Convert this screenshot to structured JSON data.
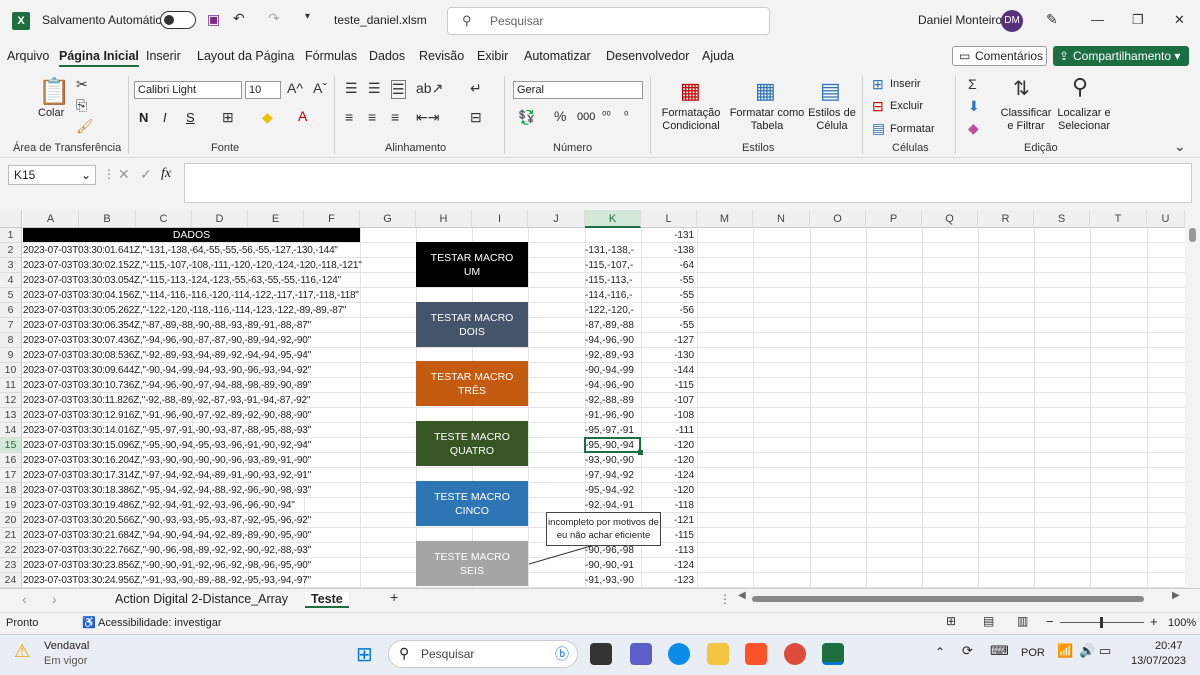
{
  "titlebar": {
    "autosave_label": "Salvamento Automático",
    "filename": "teste_daniel.xlsm",
    "search_placeholder": "Pesquisar",
    "user_name": "Daniel Monteiro",
    "user_initials": "DM"
  },
  "menu": {
    "items": [
      "Arquivo",
      "Página Inicial",
      "Inserir",
      "Layout da Página",
      "Fórmulas",
      "Dados",
      "Revisão",
      "Exibir",
      "Automatizar",
      "Desenvolvedor",
      "Ajuda"
    ],
    "comments": "Comentários",
    "share": "Compartilhamento"
  },
  "ribbon": {
    "clipboard": {
      "paste": "Colar",
      "group": "Área de Transferência"
    },
    "font": {
      "name": "Calibri Light",
      "size": "10",
      "bold": "N",
      "italic": "I",
      "underline": "S",
      "group": "Fonte"
    },
    "alignment": {
      "group": "Alinhamento"
    },
    "number": {
      "format": "Geral",
      "group": "Número"
    },
    "styles": {
      "conditional": "Formatação Condicional",
      "table": "Formatar como Tabela",
      "cell_styles": "Estilos de Célula",
      "group": "Estilos"
    },
    "cells": {
      "insert": "Inserir",
      "delete": "Excluir",
      "format": "Formatar",
      "group": "Células"
    },
    "editing": {
      "sort": "Classificar e Filtrar",
      "find": "Localizar e Selecionar",
      "group": "Edição"
    }
  },
  "formula": {
    "namebox": "K15",
    "fx": "fx",
    "value": ""
  },
  "columns": [
    "A",
    "B",
    "C",
    "D",
    "E",
    "F",
    "G",
    "H",
    "I",
    "J",
    "K",
    "L",
    "M",
    "N",
    "O",
    "P",
    "Q",
    "R",
    "S",
    "T",
    "U"
  ],
  "rows": [
    "1",
    "2",
    "3",
    "4",
    "5",
    "6",
    "7",
    "8",
    "9",
    "10",
    "11",
    "12",
    "13",
    "14",
    "15",
    "16",
    "17",
    "18",
    "19",
    "20",
    "21",
    "22",
    "23",
    "24"
  ],
  "header_cell": "DADOS",
  "colA": [
    "2023-07-03T03:30:01.641Z,\"-131,-138,-64,-55,-55,-56,-55,-127,-130,-144\"",
    "2023-07-03T03:30:02.152Z,\"-115,-107,-108,-111,-120,-120,-124,-120,-118,-121\"",
    "2023-07-03T03:30:03.054Z,\"-115,-113,-124,-123,-55,-63,-55,-55,-116,-124\"",
    "2023-07-03T03:30:04.156Z,\"-114,-116,-116,-120,-114,-122,-117,-117,-118,-118\"",
    "2023-07-03T03:30:05.262Z,\"-122,-120,-118,-116,-114,-123,-122,-89,-89,-87\"",
    "2023-07-03T03:30:06.354Z,\"-87,-89,-88,-90,-88,-93,-89,-91,-88,-87\"",
    "2023-07-03T03:30:07.436Z,\"-94,-96,-90,-87,-87,-90,-89,-94,-92,-90\"",
    "2023-07-03T03:30:08.536Z,\"-92,-89,-93,-94,-89,-92,-94,-94,-95,-94\"",
    "2023-07-03T03:30:09.644Z,\"-90,-94,-99,-94,-93,-90,-96,-93,-94,-92\"",
    "2023-07-03T03:30:10.736Z,\"-94,-96,-90,-97,-94,-88,-98,-89,-90,-89\"",
    "2023-07-03T03:30:11.826Z,\"-92,-88,-89,-92,-87,-93,-91,-94,-87,-92\"",
    "2023-07-03T03:30:12.916Z,\"-91,-96,-90,-97,-92,-89,-92,-90,-88,-90\"",
    "2023-07-03T03:30:14.016Z,\"-95,-97,-91,-90,-93,-87,-88,-95,-88,-93\"",
    "2023-07-03T03:30:15.096Z,\"-95,-90,-94,-95,-93,-96,-91,-90,-92,-94\"",
    "2023-07-03T03:30:16.204Z,\"-93,-90,-90,-90,-90,-96,-93,-89,-91,-90\"",
    "2023-07-03T03:30:17.314Z,\"-97,-94,-92,-94,-89,-91,-90,-93,-92,-91\"",
    "2023-07-03T03:30:18.386Z,\"-95,-94,-92,-94,-88,-92,-96,-90,-98,-93\"",
    "2023-07-03T03:30:19.486Z,\"-92,-94,-91,-92,-93,-96,-96,-90,-94\"",
    "2023-07-03T03:30:20.566Z,\"-90,-93,-93,-95,-93,-87,-92,-95,-96,-92\"",
    "2023-07-03T03:30:21.684Z,\"-94,-90,-94,-94,-92,-89,-89,-90,-95,-90\"",
    "2023-07-03T03:30:22.766Z,\"-90,-96,-98,-89,-92,-92,-90,-92,-88,-93\"",
    "2023-07-03T03:30:23.856Z,\"-90,-90,-91,-92,-96,-92,-98,-96,-95,-90\"",
    "2023-07-03T03:30:24.956Z,\"-91,-93,-90,-89,-88,-92,-95,-93,-94,-97\""
  ],
  "colK": [
    "",
    "-131,-138,-",
    "-115,-107,-",
    "-115,-113,-",
    "-114,-116,-",
    "-122,-120,-",
    "-87,-89,-88",
    "-94,-96,-90",
    "-92,-89,-93",
    "-90,-94,-99",
    "-94,-96,-90",
    "-92,-88,-89",
    "-91,-96,-90",
    "-95,-97,-91",
    "-95,-90,-94",
    "-93,-90,-90",
    "-97,-94,-92",
    "-95,-94,-92",
    "-92,-94,-91",
    "",
    "",
    "-90,-96,-98",
    "-90,-90,-91",
    "-91,-93,-90"
  ],
  "colL": [
    "-131",
    "-138",
    "-64",
    "-55",
    "-55",
    "-56",
    "-55",
    "-127",
    "-130",
    "-144",
    "-115",
    "-107",
    "-108",
    "-111",
    "-120",
    "-120",
    "-124",
    "-120",
    "-118",
    "-121",
    "-115",
    "-113",
    "-124",
    "-123"
  ],
  "macros": [
    {
      "label": "TESTAR MACRO UM",
      "color": "#000000"
    },
    {
      "label": "TESTAR MACRO DOIS",
      "color": "#44546a"
    },
    {
      "label": "TESTAR MACRO TRÊS",
      "color": "#c55a11"
    },
    {
      "label": "TESTE MACRO QUATRO",
      "color": "#375623"
    },
    {
      "label": "TESTE MACRO CINCO",
      "color": "#2e75b6"
    },
    {
      "label": "TESTE MACRO SEIS",
      "color": "#a5a5a5"
    }
  ],
  "note": "incompleto por motivos de eu não achar eficiente",
  "sheets": {
    "tab1": "Action Digital 2-Distance_Array",
    "tab2": "Teste"
  },
  "status": {
    "ready": "Pronto",
    "accessibility": "Acessibilidade: investigar",
    "zoom": "100%"
  },
  "taskbar": {
    "weather_title": "Vendaval",
    "weather_sub": "Em vigor",
    "search": "Pesquisar",
    "lang": "POR",
    "time": "20:47",
    "date": "13/07/2023"
  }
}
